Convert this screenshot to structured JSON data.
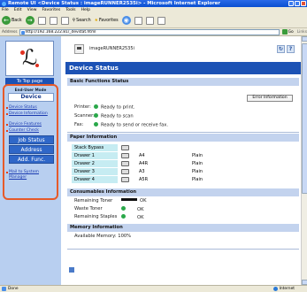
{
  "window": {
    "title": "Remote UI <Device Status : imageRUNNER2535i> - Microsoft Internet Explorer"
  },
  "menu": [
    "File",
    "Edit",
    "View",
    "Favorites",
    "Tools",
    "Help"
  ],
  "toolbar": {
    "back": "Back",
    "search": "Search",
    "favorites": "Favorites"
  },
  "address": {
    "label": "Address",
    "url": "http://192.168.222.81/_devstat.html",
    "go": "Go",
    "links": "Links"
  },
  "nav": {
    "to_top": "To Top page",
    "mode": "End-User Mode",
    "device": "Device",
    "links": [
      "Device Status",
      "Device Information",
      "Device Features",
      "Counter Check"
    ],
    "buttons": [
      "Job Status",
      "Address",
      "Add. Func."
    ],
    "mail": "Mail to System Manager"
  },
  "header": {
    "device_name": "imageRUNNER2535i"
  },
  "page_title": "Device Status",
  "basic": {
    "heading": "Basic Functions Status",
    "error_button": "Error Information",
    "items": [
      {
        "label": "Printer:",
        "status": "Ready to print."
      },
      {
        "label": "Scanner:",
        "status": "Ready to scan"
      },
      {
        "label": "Fax:",
        "status": "Ready to send or receive fax."
      }
    ]
  },
  "paper": {
    "heading": "Paper Information",
    "rows": [
      {
        "source": "Stack Bypass",
        "size": "",
        "type": ""
      },
      {
        "source": "Drawer 1",
        "size": "A4",
        "type": "Plain"
      },
      {
        "source": "Drawer 2",
        "size": "A4R",
        "type": "Plain"
      },
      {
        "source": "Drawer 3",
        "size": "A3",
        "type": "Plain"
      },
      {
        "source": "Drawer 4",
        "size": "A5R",
        "type": "Plain"
      }
    ]
  },
  "consumables": {
    "heading": "Consumables Information",
    "items": [
      {
        "label": "Remaining Toner",
        "status": "OK"
      },
      {
        "label": "Waste Toner",
        "status": "OK"
      },
      {
        "label": "Remaining Staples",
        "status": "OK"
      }
    ]
  },
  "memory": {
    "heading": "Memory Information",
    "label": "Available Memory:",
    "value": "100%"
  },
  "status": {
    "left": "Done",
    "zone": "Internet"
  },
  "colors": {
    "accent": "#1c52b5",
    "nav_bg": "#b8cff0",
    "highlight": "#e65a2a",
    "ok": "#2aa84a"
  }
}
